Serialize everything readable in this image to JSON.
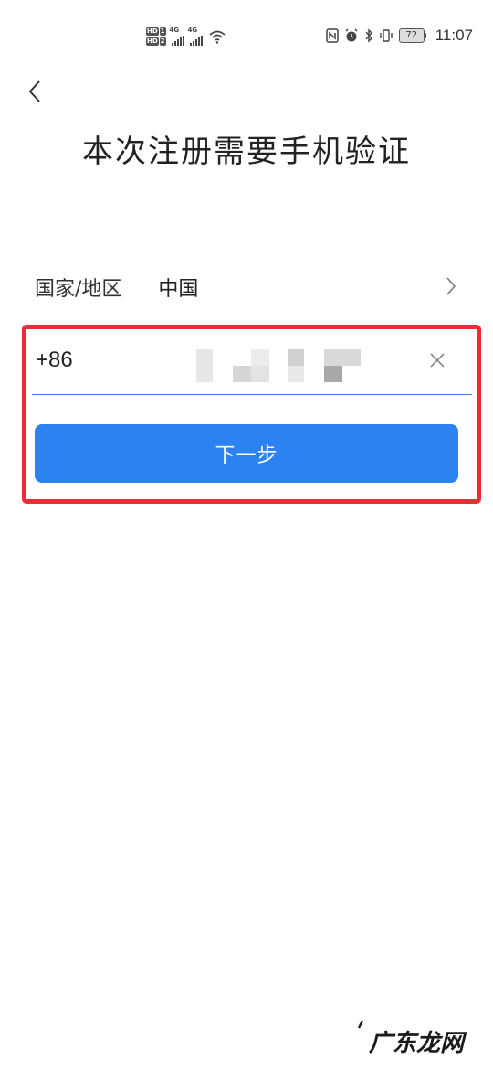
{
  "status_bar": {
    "sim1": {
      "hd": "HD",
      "num": "1",
      "network": "4G"
    },
    "sim2": {
      "hd": "HD",
      "num": "2",
      "network": "4G"
    },
    "icons": [
      "nfc-icon",
      "alarm-icon",
      "bluetooth-icon",
      "vibrate-icon"
    ],
    "battery": "72",
    "time": "11:07"
  },
  "header": {
    "title": "本次注册需要手机验证"
  },
  "country_row": {
    "label": "国家/地区",
    "value": "中国"
  },
  "phone": {
    "dial_code": "+86",
    "value_masked": true
  },
  "next_button": {
    "label": "下一步"
  },
  "watermark": {
    "text": "广东龙网"
  },
  "colors": {
    "accent": "#2b82f0",
    "highlight": "#f02b38",
    "underline": "#3b82f6"
  }
}
